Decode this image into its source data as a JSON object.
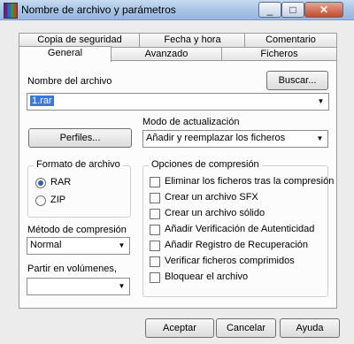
{
  "window": {
    "title": "Nombre de archivo y parámetros",
    "minimize_glyph": "_",
    "maximize_glyph": "□",
    "close_glyph": "✕"
  },
  "tabs": {
    "top_row": [
      "Copia de seguridad",
      "Fecha y hora",
      "Comentario"
    ],
    "bottom_row": [
      "General",
      "Avanzado",
      "Ficheros"
    ],
    "active": "General"
  },
  "general": {
    "filename_label": "Nombre del archivo",
    "browse_button": "Buscar...",
    "filename_value": "1.rar",
    "profiles_button": "Perfiles...",
    "update_mode_label": "Modo de actualización",
    "update_mode_value": "Añadir y reemplazar los ficheros",
    "format_group_label": "Formato de archivo",
    "format_options": [
      "RAR",
      "ZIP"
    ],
    "format_selected": "RAR",
    "compression_method_label": "Método de compresión",
    "compression_method_value": "Normal",
    "split_volumes_label": "Partir en volúmenes,",
    "split_volumes_value": "",
    "options_group_label": "Opciones de compresión",
    "options": [
      "Eliminar los ficheros tras la compresión",
      "Crear un archivo SFX",
      "Crear un archivo sólido",
      "Añadir Verificación de Autenticidad",
      "Añadir Registro de Recuperación",
      "Verificar ficheros comprimidos",
      "Bloquear el archivo"
    ]
  },
  "footer": {
    "ok_button": "Aceptar",
    "cancel_button": "Cancelar",
    "help_button": "Ayuda"
  },
  "icons": {
    "dropdown": "chevron-down-icon",
    "app": "winrar-icon"
  }
}
